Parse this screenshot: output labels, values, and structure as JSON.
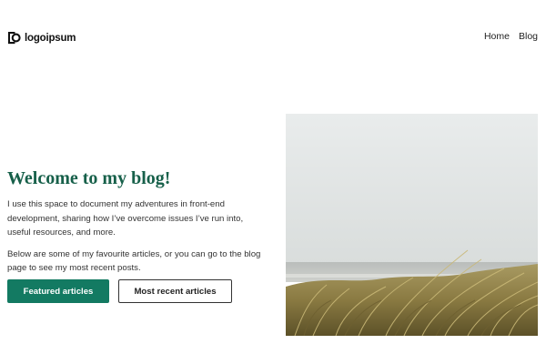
{
  "header": {
    "logo_text": "logoipsum",
    "nav": {
      "home_label": "Home",
      "blog_label": "Blog"
    }
  },
  "hero": {
    "title": "Welcome to my blog!",
    "paragraph_1": "I use this space to document my adventures in front-end development, sharing how I’ve overcome issues I’ve run into, useful resources, and more.",
    "paragraph_2": "Below are some of my favourite articles, or you can go to the blog page to see my most recent posts.",
    "primary_button_label": "Featured articles",
    "secondary_button_label": "Most recent articles",
    "image": "beach-dune-grass-photo"
  },
  "colors": {
    "accent": "#137a62",
    "title": "#17604a"
  }
}
